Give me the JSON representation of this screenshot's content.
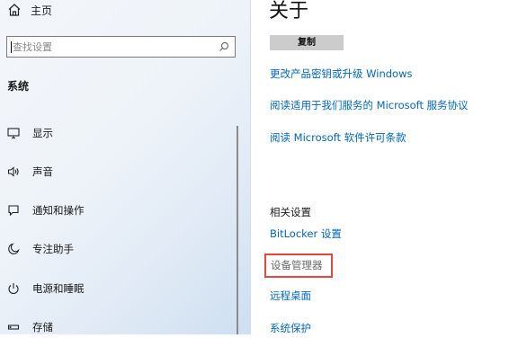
{
  "sidebar": {
    "home_label": "主页",
    "search_placeholder": "查找设置",
    "section_title": "系统",
    "items": [
      {
        "label": "显示",
        "icon": "monitor-icon"
      },
      {
        "label": "声音",
        "icon": "speaker-icon"
      },
      {
        "label": "通知和操作",
        "icon": "notification-icon"
      },
      {
        "label": "专注助手",
        "icon": "moon-icon"
      },
      {
        "label": "电源和睡眠",
        "icon": "power-icon"
      },
      {
        "label": "存储",
        "icon": "storage-icon"
      }
    ]
  },
  "main": {
    "title": "关于",
    "copy_button": "复制",
    "links": [
      "更改产品密钥或升级 Windows",
      "阅读适用于我们服务的 Microsoft 服务协议",
      "阅读 Microsoft 软件许可条款"
    ],
    "related": {
      "title": "相关设置",
      "links": [
        "BitLocker 设置",
        "设备管理器",
        "远程桌面",
        "系统保护"
      ]
    }
  },
  "colors": {
    "link": "#0067b8",
    "highlight_border": "#e5483b",
    "copy_button_bg": "#cccccc"
  }
}
